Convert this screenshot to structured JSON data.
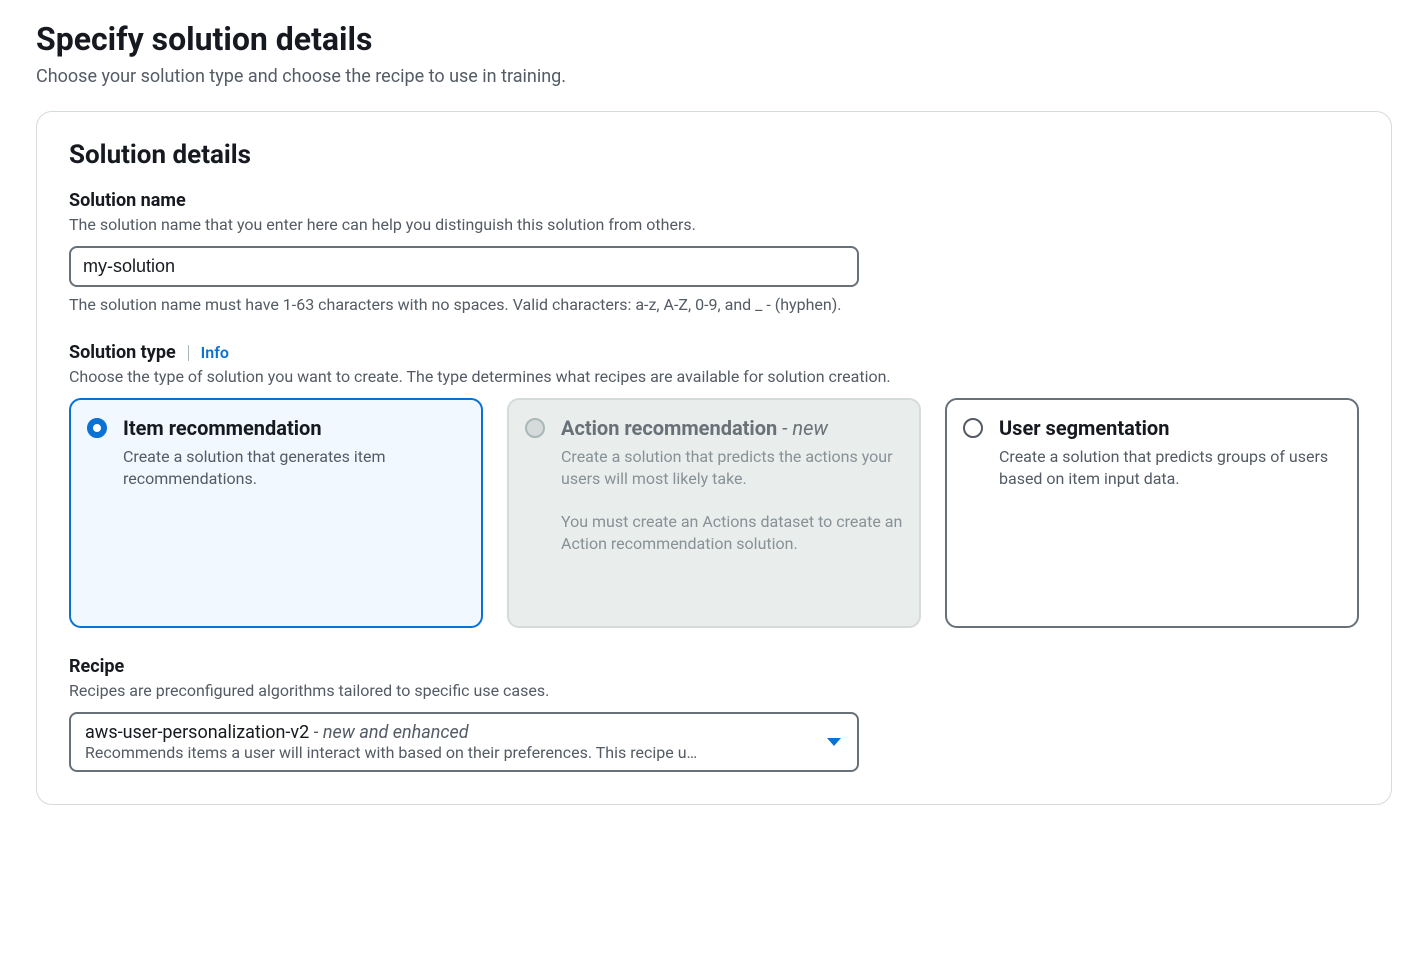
{
  "page": {
    "title": "Specify solution details",
    "subtitle": "Choose your solution type and choose the recipe to use in training."
  },
  "panel": {
    "title": "Solution details"
  },
  "solutionName": {
    "label": "Solution name",
    "desc": "The solution name that you enter here can help you distinguish this solution from others.",
    "value": "my-solution",
    "help": "The solution name must have 1-63 characters with no spaces. Valid characters: a-z, A-Z, 0-9, and _ - (hyphen)."
  },
  "solutionType": {
    "label": "Solution type",
    "info": "Info",
    "desc": "Choose the type of solution you want to create. The type determines what recipes are available for solution creation.",
    "options": [
      {
        "title": "Item recommendation",
        "badge": "",
        "body": "Create a solution that generates item recommendations.",
        "extra": ""
      },
      {
        "title": "Action recommendation",
        "badge": " - new",
        "body": "Create a solution that predicts the actions your users will most likely take.",
        "extra": "You must create an Actions dataset to create an Action recommendation solution."
      },
      {
        "title": "User segmentation",
        "badge": "",
        "body": "Create a solution that predicts groups of users based on item input data.",
        "extra": ""
      }
    ]
  },
  "recipe": {
    "label": "Recipe",
    "desc": "Recipes are preconfigured algorithms tailored to specific use cases.",
    "selectedName": "aws-user-personalization-v2",
    "selectedTag": " - new and enhanced",
    "selectedDesc": "Recommends items a user will interact with based on their preferences. This recipe u…"
  }
}
